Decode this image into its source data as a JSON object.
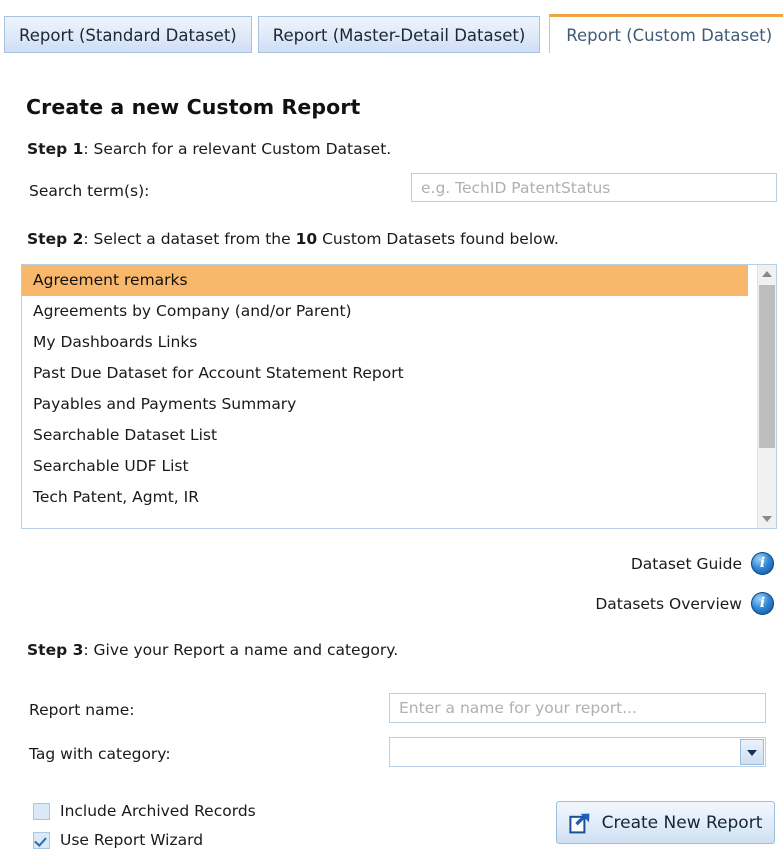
{
  "tabs": [
    {
      "label": "Report (Standard Dataset)",
      "active": false
    },
    {
      "label": "Report (Master-Detail Dataset)",
      "active": false
    },
    {
      "label": "Report (Custom Dataset)",
      "active": true
    }
  ],
  "page": {
    "title": "Create a new Custom Report"
  },
  "step1": {
    "prefix": "Step 1",
    "text": ": Search for a relevant Custom Dataset.",
    "search_label": "Search term(s):",
    "search_value": "",
    "search_placeholder": "e.g. TechID PatentStatus"
  },
  "step2": {
    "prefix": "Step 2",
    "text_before_count": ": Select a dataset from the ",
    "count": "10",
    "text_after_count": " Custom Datasets found below.",
    "datasets": [
      "Agreement remarks",
      "Agreements by Company (and/or Parent)",
      "My Dashboards Links",
      "Past Due Dataset for Account Statement Report",
      "Payables and Payments Summary",
      "Searchable Dataset List",
      "Searchable UDF List",
      "Tech Patent, Agmt, IR"
    ],
    "selected_index": 0,
    "scrollbar": {
      "up_icon": "caret-up-icon",
      "down_icon": "caret-down-icon"
    },
    "links": [
      {
        "label": "Dataset Guide",
        "icon": "info-icon",
        "glyph": "i"
      },
      {
        "label": "Datasets Overview",
        "icon": "info-icon",
        "glyph": "i"
      }
    ]
  },
  "step3": {
    "prefix": "Step 3",
    "text": ": Give your Report a name and category.",
    "report_name_label": "Report name:",
    "report_name_value": "",
    "report_name_placeholder": "Enter a name for your report...",
    "category_label": "Tag with category:",
    "category_value": "",
    "category_arrow_icon": "chevron-down-icon",
    "checkboxes": [
      {
        "label": "Include Archived Records",
        "checked": false
      },
      {
        "label": "Use Report Wizard",
        "checked": true
      }
    ],
    "submit": {
      "label": "Create New Report",
      "icon": "export-arrow-icon"
    }
  },
  "colors": {
    "accent_orange": "#f0a542",
    "selection_orange": "#f8b86c",
    "tab_blue": "#cfdef4",
    "border_blue": "#b8cfe5",
    "info_blue": "#2f86d4"
  }
}
